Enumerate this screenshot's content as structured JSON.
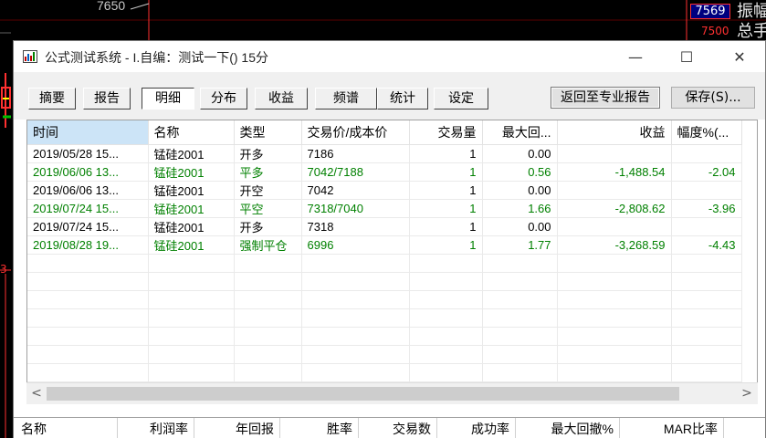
{
  "background": {
    "price_top": "7650",
    "price_box": "7569",
    "price_low": "7500",
    "right_chars": "振幅\n总手",
    "side_number": "3"
  },
  "window": {
    "title": "公式测试系统 - I.自编：测试一下() 15分",
    "controls": {
      "minimize": "—",
      "maximize": "☐",
      "close": "✕"
    }
  },
  "tabs": [
    {
      "label": "摘要"
    },
    {
      "label": "报告"
    },
    {
      "label": "明细"
    },
    {
      "label": "分布"
    },
    {
      "label": "收益"
    },
    {
      "label": "频谱"
    },
    {
      "label": "统计"
    },
    {
      "label": "设定"
    }
  ],
  "toolbar": {
    "back_label": "返回至专业报告",
    "save_label": "保存(S)..."
  },
  "table": {
    "headers": [
      "时间",
      "名称",
      "类型",
      "交易价/成本价",
      "交易量",
      "最大回...",
      "收益",
      "幅度%(..."
    ],
    "rows": [
      {
        "time": "2019/05/28 15...",
        "name": "锰硅2001",
        "type": "开多",
        "price": "7186",
        "qty": "1",
        "drawdown": "0.00",
        "profit": "",
        "pct": "",
        "color": "black"
      },
      {
        "time": "2019/06/06 13...",
        "name": "锰硅2001",
        "type": "平多",
        "price": "7042/7188",
        "qty": "1",
        "drawdown": "0.56",
        "profit": "-1,488.54",
        "pct": "-2.04",
        "color": "green"
      },
      {
        "time": "2019/06/06 13...",
        "name": "锰硅2001",
        "type": "开空",
        "price": "7042",
        "qty": "1",
        "drawdown": "0.00",
        "profit": "",
        "pct": "",
        "color": "black"
      },
      {
        "time": "2019/07/24 15...",
        "name": "锰硅2001",
        "type": "平空",
        "price": "7318/7040",
        "qty": "1",
        "drawdown": "1.66",
        "profit": "-2,808.62",
        "pct": "-3.96",
        "color": "green"
      },
      {
        "time": "2019/07/24 15...",
        "name": "锰硅2001",
        "type": "开多",
        "price": "7318",
        "qty": "1",
        "drawdown": "0.00",
        "profit": "",
        "pct": "",
        "color": "black"
      },
      {
        "time": "2019/08/28 19...",
        "name": "锰硅2001",
        "type": "强制平仓",
        "price": "6996",
        "qty": "1",
        "drawdown": "1.77",
        "profit": "-3,268.59",
        "pct": "-4.43",
        "color": "green"
      }
    ]
  },
  "scrollbar": {
    "left_arrow": "<",
    "right_arrow": ">"
  },
  "summary": {
    "headers": [
      "名称",
      "利润率",
      "年回报",
      "胜率",
      "交易数",
      "成功率",
      "最大回撤%",
      "MAR比率"
    ]
  },
  "colors": {
    "profit_loss_green": "#008000",
    "header_selected": "#cce4f7",
    "chart_red": "#ff3030",
    "chart_green": "#00c000"
  }
}
